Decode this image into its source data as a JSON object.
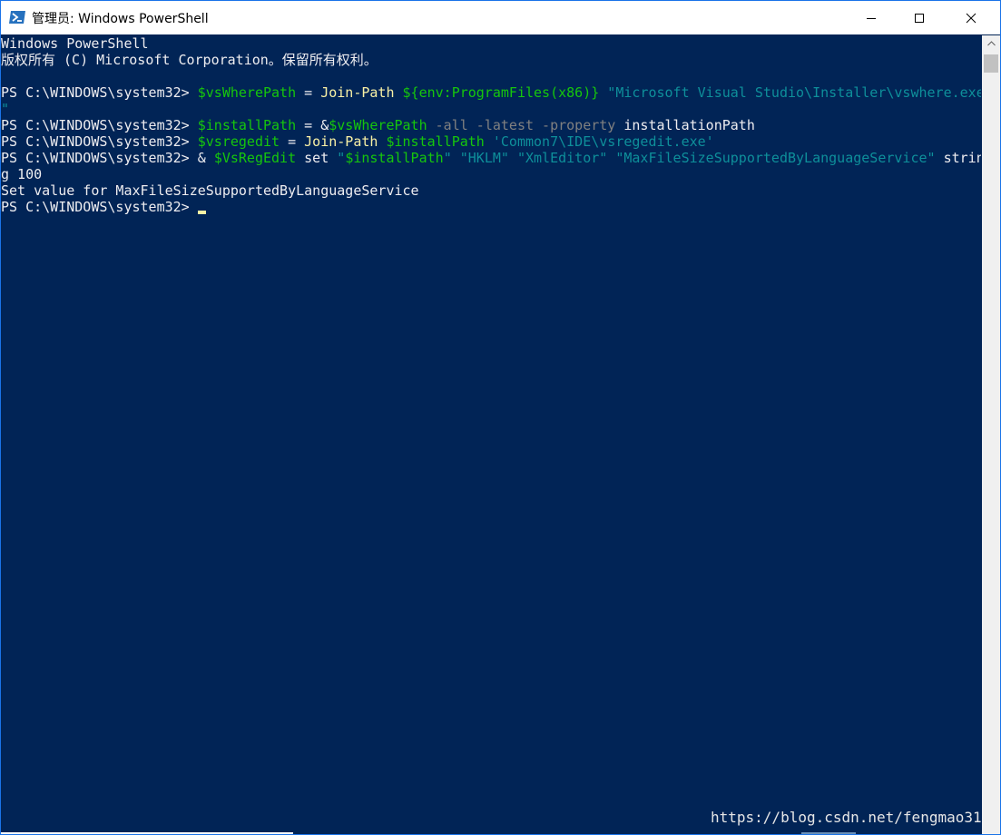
{
  "window": {
    "title": "管理员: Windows PowerShell",
    "controls": {
      "minimize": "minimize",
      "maximize": "maximize",
      "close": "close"
    }
  },
  "console": {
    "header_line1": "Windows PowerShell",
    "header_line2": "版权所有 (C) Microsoft Corporation。保留所有权利。",
    "prompt": "PS C:\\WINDOWS\\system32> ",
    "cmd1": {
      "var": "$vsWherePath",
      "eq": " = ",
      "command": "Join-Path",
      "arg": " ${env:ProgramFiles(x86)}",
      "string": " \"Microsoft Visual Studio\\Installer\\vswhere.exe",
      "wrap": "\""
    },
    "cmd2": {
      "var": "$installPath",
      "eq": " = &",
      "var2": "$vsWherePath",
      "params": " -all -latest -property",
      "arg": " installationPath"
    },
    "cmd3": {
      "var": "$vsregedit",
      "eq": " = ",
      "command": "Join-Path",
      "var2": " $installPath",
      "string": " 'Common7\\IDE\\vsregedit.exe'"
    },
    "cmd4": {
      "amp": "& ",
      "var": "$VsRegEdit",
      "set": " set ",
      "str1_q": "\"",
      "str1_var": "$installPath",
      "str1_end": "\"",
      "str2": " \"HKLM\"",
      "str3": " \"XmlEditor\"",
      "str4": " \"MaxFileSizeSupportedByLanguageService\"",
      "arg": " strin",
      "wrap": "g 100"
    },
    "output": "Set value for MaxFileSizeSupportedByLanguageService"
  },
  "watermark": "https://blog.csdn.net/fengmao31",
  "colors": {
    "background": "#012456",
    "variable": "#16c60c",
    "command": "#f9f1a5",
    "string": "#0e8f9a",
    "parameter": "#808080"
  }
}
